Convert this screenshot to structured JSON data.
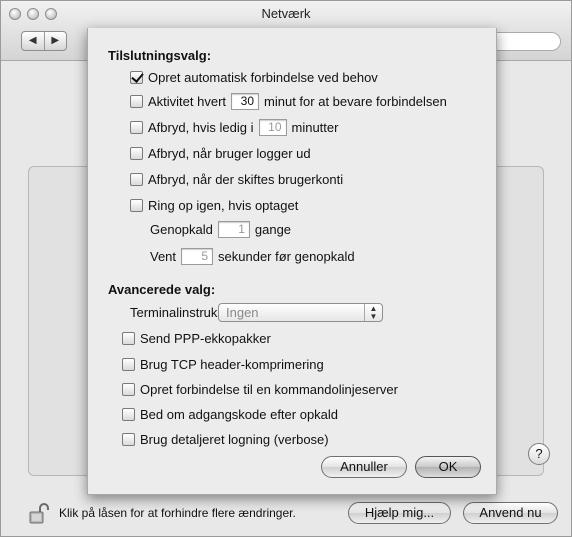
{
  "window": {
    "title": "Netværk",
    "search_placeholder": "Q"
  },
  "footer": {
    "lock_text": "Klik på låsen for at forhindre flere ændringer.",
    "help_button": "Hjælp mig...",
    "apply_button": "Anvend nu",
    "help_icon": "?"
  },
  "sheet": {
    "connection_heading": "Tilslutningsvalg:",
    "auto_connect": {
      "label": "Opret automatisk forbindelse ved behov",
      "checked": true
    },
    "activity": {
      "prefix": "Aktivitet hvert",
      "value": "30",
      "suffix": "minut for at bevare forbindelsen",
      "checked": false
    },
    "idle_disconnect": {
      "prefix": "Afbryd, hvis ledig i",
      "value": "10",
      "suffix": "minutter",
      "checked": false
    },
    "logout_disconnect": {
      "label": "Afbryd, når bruger logger ud",
      "checked": false
    },
    "switch_disconnect": {
      "label": "Afbryd, når der skiftes brugerkonti",
      "checked": false
    },
    "redial": {
      "label": "Ring op igen, hvis optaget",
      "checked": false
    },
    "redial_count": {
      "prefix": "Genopkald",
      "value": "1",
      "suffix": "gange"
    },
    "redial_wait": {
      "prefix": "Vent",
      "value": "5",
      "suffix": "sekunder før genopkald"
    },
    "advanced_heading": "Avancerede valg:",
    "terminal": {
      "label": "Terminalinstruks:",
      "selected": "Ingen"
    },
    "ppp_echo": {
      "label": "Send PPP-ekkopakker",
      "checked": false
    },
    "tcp_header": {
      "label": "Brug TCP header-komprimering",
      "checked": false
    },
    "cmdline": {
      "label": "Opret forbindelse til en kommandolinjeserver",
      "checked": false
    },
    "ask_password": {
      "label": "Bed om adgangskode efter opkald",
      "checked": false
    },
    "verbose": {
      "label": "Brug detaljeret logning (verbose)",
      "checked": false
    },
    "cancel_button": "Annuller",
    "ok_button": "OK"
  }
}
